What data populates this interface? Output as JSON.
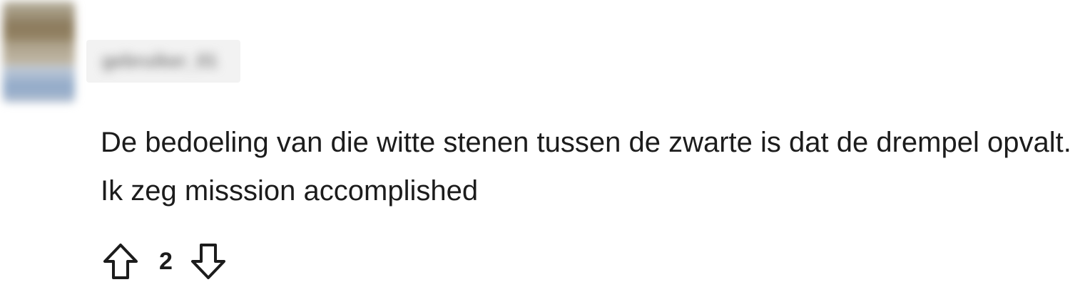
{
  "comment": {
    "author": {
      "username": "gebruiker_01",
      "avatar": "user-avatar"
    },
    "body": "De bedoeling van die witte stenen tussen de zwarte is dat de drempel opvalt. Ik zeg misssion accomplished",
    "votes": {
      "score": "2",
      "upvote_icon": "upvote-arrow-icon",
      "downvote_icon": "downvote-arrow-icon"
    }
  }
}
